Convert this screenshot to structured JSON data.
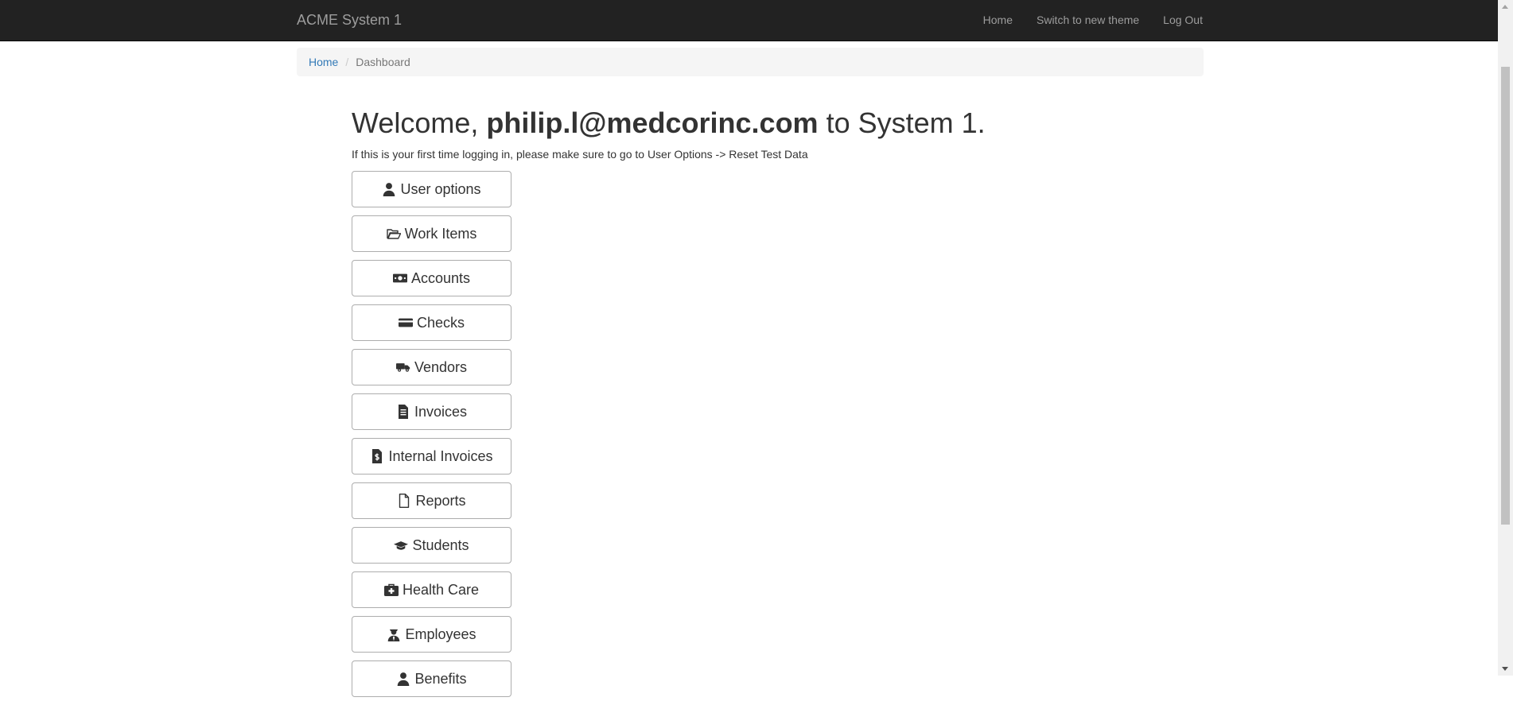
{
  "navbar": {
    "brand": "ACME System 1",
    "links": [
      "Home",
      "Switch to new theme",
      "Log Out"
    ]
  },
  "breadcrumb": {
    "home": "Home",
    "separator": "/",
    "current": "Dashboard"
  },
  "welcome": {
    "prefix": "Welcome,",
    "user": "philip.l@medcorinc.com",
    "suffix": "to System 1."
  },
  "hint": "If this is your first time logging in, please make sure to go to User Options -> Reset Test Data",
  "menu": [
    {
      "label": "User options",
      "icon": "user-icon"
    },
    {
      "label": "Work Items",
      "icon": "folder-open-icon"
    },
    {
      "label": "Accounts",
      "icon": "money-bill-icon"
    },
    {
      "label": "Checks",
      "icon": "credit-card-icon"
    },
    {
      "label": "Vendors",
      "icon": "truck-icon"
    },
    {
      "label": "Invoices",
      "icon": "file-invoice-icon"
    },
    {
      "label": "Internal Invoices",
      "icon": "file-invoice-dollar-icon"
    },
    {
      "label": "Reports",
      "icon": "file-icon"
    },
    {
      "label": "Students",
      "icon": "graduation-cap-icon"
    },
    {
      "label": "Health Care",
      "icon": "medkit-icon"
    },
    {
      "label": "Employees",
      "icon": "user-tie-icon"
    },
    {
      "label": "Benefits",
      "icon": "user-icon"
    }
  ]
}
